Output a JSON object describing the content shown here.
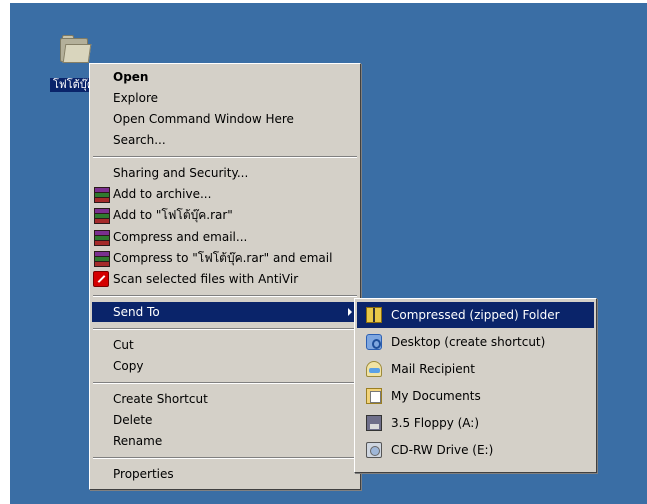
{
  "desktop": {
    "icon_label": "โฟโต้บุ๊ค"
  },
  "context_menu": {
    "items": [
      {
        "label": "Open"
      },
      {
        "label": "Explore"
      },
      {
        "label": "Open Command Window Here"
      },
      {
        "label": "Search..."
      },
      {
        "label": "Sharing and Security..."
      },
      {
        "label": "Add to archive..."
      },
      {
        "label": "Add to \"โฟโต้บุ๊ค.rar\""
      },
      {
        "label": "Compress and email..."
      },
      {
        "label": "Compress to \"โฟโต้บุ๊ค.rar\" and email"
      },
      {
        "label": "Scan selected files with AntiVir"
      },
      {
        "label": "Send To"
      },
      {
        "label": "Cut"
      },
      {
        "label": "Copy"
      },
      {
        "label": "Create Shortcut"
      },
      {
        "label": "Delete"
      },
      {
        "label": "Rename"
      },
      {
        "label": "Properties"
      }
    ]
  },
  "sendto_menu": {
    "items": [
      {
        "label": "Compressed (zipped) Folder"
      },
      {
        "label": "Desktop (create shortcut)"
      },
      {
        "label": "Mail Recipient"
      },
      {
        "label": "My Documents"
      },
      {
        "label": "3.5 Floppy (A:)"
      },
      {
        "label": "CD-RW Drive (E:)"
      }
    ]
  },
  "colors": {
    "desktop": "#3a6ea5",
    "menu": "#d4d0c8",
    "highlight": "#0a246a"
  }
}
